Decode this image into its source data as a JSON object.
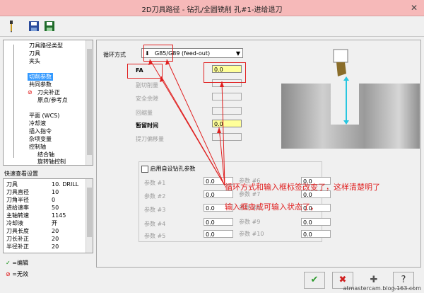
{
  "window": {
    "title": "2D刀具路径 - 钻孔/全圆铣削 孔#1-进给退刀",
    "close_glyph": "✕"
  },
  "toolbar": {
    "icons": [
      "tool-icon",
      "save-icon",
      "save-as-icon"
    ]
  },
  "tree": {
    "items": [
      {
        "label": "刀具路径类型",
        "indent": 1
      },
      {
        "label": "刀具",
        "indent": 1
      },
      {
        "label": "夹头",
        "indent": 1
      },
      {
        "label": "切削参数",
        "indent": 1,
        "selected": true
      },
      {
        "label": "共同参数",
        "indent": 1
      },
      {
        "label": "刀尖补正",
        "indent": 2,
        "invalid": true
      },
      {
        "label": "原点/参考点",
        "indent": 2
      },
      {
        "label": "平面 (WCS)",
        "indent": 1
      },
      {
        "label": "冷却液",
        "indent": 1
      },
      {
        "label": "插入指令",
        "indent": 1
      },
      {
        "label": "杂项变量",
        "indent": 1
      },
      {
        "label": "控制轴",
        "indent": 1
      },
      {
        "label": "结合轴",
        "indent": 2
      },
      {
        "label": "旋转轴控制",
        "indent": 2
      }
    ]
  },
  "quick_view": {
    "label": "快速查看设置",
    "rows": [
      {
        "k": "刀具",
        "v": "10. DRILL"
      },
      {
        "k": "刀具直径",
        "v": "10"
      },
      {
        "k": "刀角半径",
        "v": "0"
      },
      {
        "k": "进给速率",
        "v": "50"
      },
      {
        "k": "主轴转速",
        "v": "1145"
      },
      {
        "k": "冷却液",
        "v": "开"
      },
      {
        "k": "刀具长度",
        "v": "20"
      },
      {
        "k": "刀长补正",
        "v": "20"
      },
      {
        "k": "半径补正",
        "v": "20"
      }
    ]
  },
  "legend": {
    "edit": "=编辑",
    "invalid": "=无效"
  },
  "params": {
    "cycle_label": "循环方式",
    "cycle_value": "G85/G89 (feed-out)",
    "fields": [
      {
        "label": "FA",
        "value": "0.0",
        "state": "yellow"
      },
      {
        "label": "副切削量",
        "value": "",
        "state": "disabled"
      },
      {
        "label": "安全余隙",
        "value": "",
        "state": "disabled"
      },
      {
        "label": "回缩量",
        "value": "",
        "state": "disabled"
      },
      {
        "label": "暂留时间",
        "value": "0.0",
        "state": "yellow"
      },
      {
        "label": "提刀偏移量",
        "value": "",
        "state": "disabled"
      }
    ],
    "custom_checkbox_label": "启用自设钻孔参数",
    "custom_params_left": [
      {
        "label": "参数 #1",
        "value": "0.0"
      },
      {
        "label": "参数 #2",
        "value": "0.0"
      },
      {
        "label": "参数 #3",
        "value": "0.0"
      },
      {
        "label": "参数 #4",
        "value": "0.0"
      },
      {
        "label": "参数 #5",
        "value": "0.0"
      }
    ],
    "custom_params_right": [
      {
        "label": "参数 #6",
        "value": "0.0"
      },
      {
        "label": "参数 #7",
        "value": "0.0"
      },
      {
        "label": "参数 #8",
        "value": "0.0"
      },
      {
        "label": "参数 #9",
        "value": "0.0"
      },
      {
        "label": "参数 #10",
        "value": "0.0"
      }
    ]
  },
  "annotation": {
    "line1": "循环方式和输入框标签改变了，这样清楚明了",
    "line2": "输入框变成可输入状态了，"
  },
  "buttons": {
    "ok": "✔",
    "cancel": "✖",
    "add": "✚",
    "help": "?"
  },
  "watermark": "atmastercam.blog.163.com",
  "colors": {
    "accent_red": "#e02020",
    "highlight_yellow": "#ffff99",
    "selection_blue": "#3399ff",
    "titlebar": "#f6b9b9"
  }
}
